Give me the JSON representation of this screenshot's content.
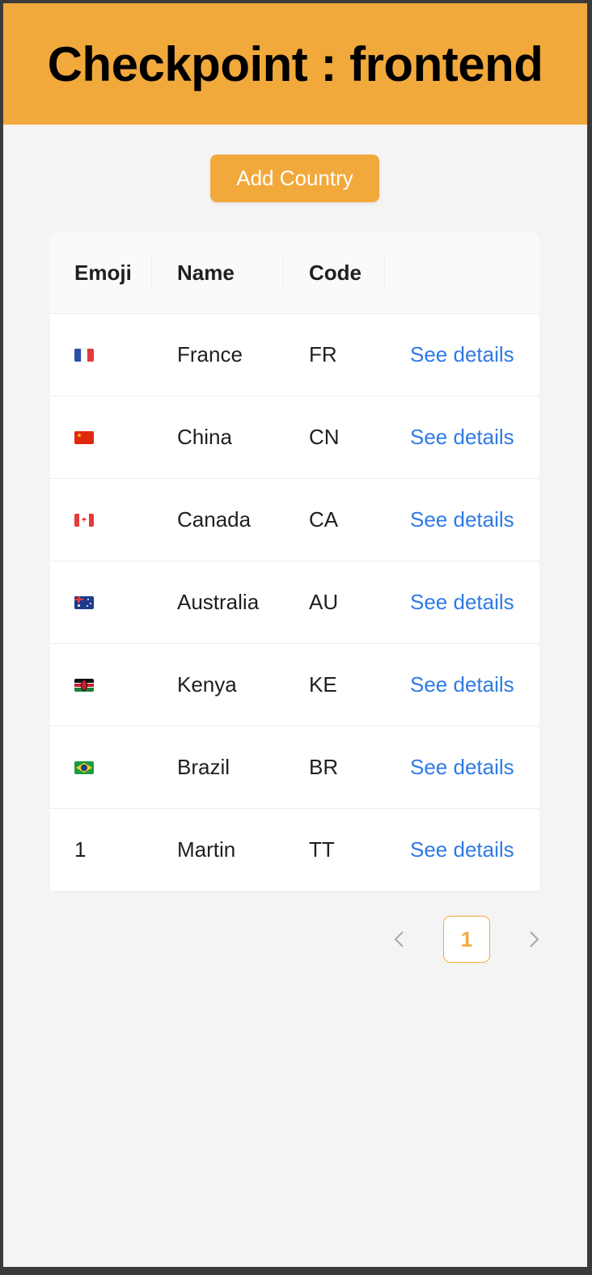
{
  "header": {
    "title": "Checkpoint : frontend"
  },
  "actions": {
    "add_country_label": "Add Country"
  },
  "table": {
    "columns": [
      "Emoji",
      "Name",
      "Code",
      ""
    ],
    "rows": [
      {
        "emoji": "🇫🇷",
        "flag": "fr",
        "name": "France",
        "code": "FR",
        "action": "See details"
      },
      {
        "emoji": "🇨🇳",
        "flag": "cn",
        "name": "China",
        "code": "CN",
        "action": "See details"
      },
      {
        "emoji": "🇨🇦",
        "flag": "ca",
        "name": "Canada",
        "code": "CA",
        "action": "See details"
      },
      {
        "emoji": "🇦🇺",
        "flag": "au",
        "name": "Australia",
        "code": "AU",
        "action": "See details"
      },
      {
        "emoji": "🇰🇪",
        "flag": "ke",
        "name": "Kenya",
        "code": "KE",
        "action": "See details"
      },
      {
        "emoji": "🇧🇷",
        "flag": "br",
        "name": "Brazil",
        "code": "BR",
        "action": "See details"
      },
      {
        "emoji": "1",
        "flag": null,
        "name": "Martin",
        "code": "TT",
        "action": "See details"
      }
    ]
  },
  "pagination": {
    "current_page": "1",
    "prev_icon": "chevron-left-icon",
    "next_icon": "chevron-right-icon"
  },
  "colors": {
    "accent": "#f2a93b",
    "link": "#2f7ae5",
    "background": "#f4f4f4"
  }
}
